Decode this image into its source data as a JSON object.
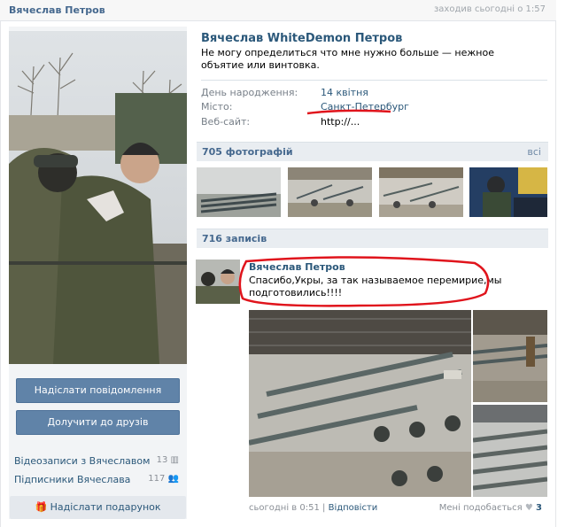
{
  "header": {
    "name": "Вячеслав Петров",
    "online": "заходив сьогодні о 1:57"
  },
  "profile": {
    "full_name": "Вячеслав WhiteDemon Петров",
    "status": "Не могу определиться что мне нужно больше — нежное объятие или винтовка.",
    "info": [
      {
        "label": "День народження:",
        "value": "14 квітня"
      },
      {
        "label": "Місто:",
        "value": "Санкт-Петербург"
      },
      {
        "label": "Веб-сайт:",
        "value": "http://..."
      }
    ]
  },
  "sidebar": {
    "send_message": "Надіслати повідомлення",
    "add_friend": "Долучити до друзів",
    "videos_label": "Відеозаписи з Вячеславом",
    "videos_count": "13",
    "subscribers_label": "Підписники Вячеслава",
    "subscribers_count": "117",
    "gift": "Надіслати подарунок"
  },
  "photos": {
    "title": "705 фотографій",
    "all": "всі"
  },
  "wall": {
    "title": "716 записів",
    "post": {
      "author": "Вячеслав Петров",
      "text": "Спасибо,Укры, за так называемое перемирие,мы подготовились!!!!",
      "time": "сьогодні в 0:51",
      "separator": "|",
      "reply": "Відповісти",
      "likes_label": "Мені подобається",
      "likes_count": "3"
    }
  },
  "colors": {
    "link": "#2b587a",
    "button": "#6083a8",
    "annotation": "#e0141c"
  }
}
